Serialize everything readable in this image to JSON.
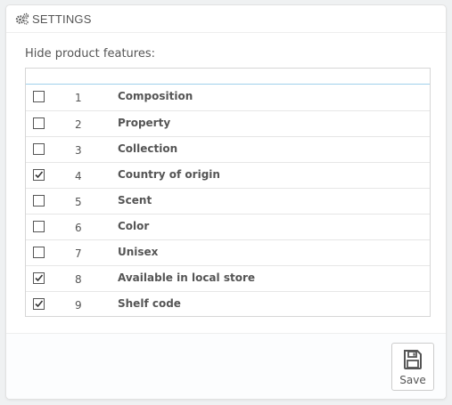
{
  "panel": {
    "title": "SETTINGS",
    "title_icon": "cogs-icon"
  },
  "form": {
    "label": "Hide product features:"
  },
  "features": [
    {
      "id": "1",
      "name": "Composition",
      "checked": false
    },
    {
      "id": "2",
      "name": "Property",
      "checked": false
    },
    {
      "id": "3",
      "name": "Collection",
      "checked": false
    },
    {
      "id": "4",
      "name": "Country of origin",
      "checked": true
    },
    {
      "id": "5",
      "name": "Scent",
      "checked": false
    },
    {
      "id": "6",
      "name": "Color",
      "checked": false
    },
    {
      "id": "7",
      "name": "Unisex",
      "checked": false
    },
    {
      "id": "8",
      "name": "Available in local store",
      "checked": true
    },
    {
      "id": "9",
      "name": "Shelf code",
      "checked": true
    }
  ],
  "footer": {
    "save_label": "Save",
    "save_icon": "floppy-disk-icon"
  },
  "colors": {
    "header_underline": "#a0d0eb",
    "text": "#555555",
    "background": "#eff1f2"
  }
}
